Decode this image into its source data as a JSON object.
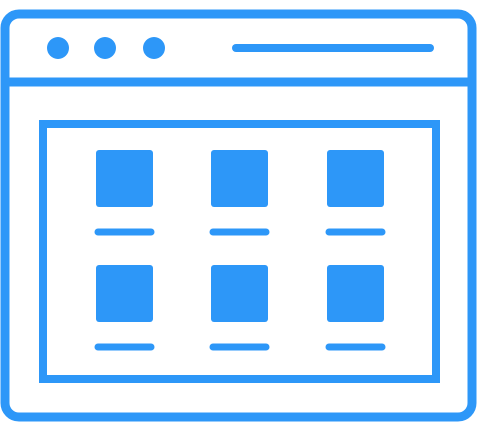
{
  "icon": {
    "name": "browser-window-grid-icon",
    "stroke_color": "#2D97F8",
    "fill_color": "#2D97F8",
    "window_dots_count": 3,
    "grid": {
      "rows": 2,
      "cols": 3
    }
  }
}
